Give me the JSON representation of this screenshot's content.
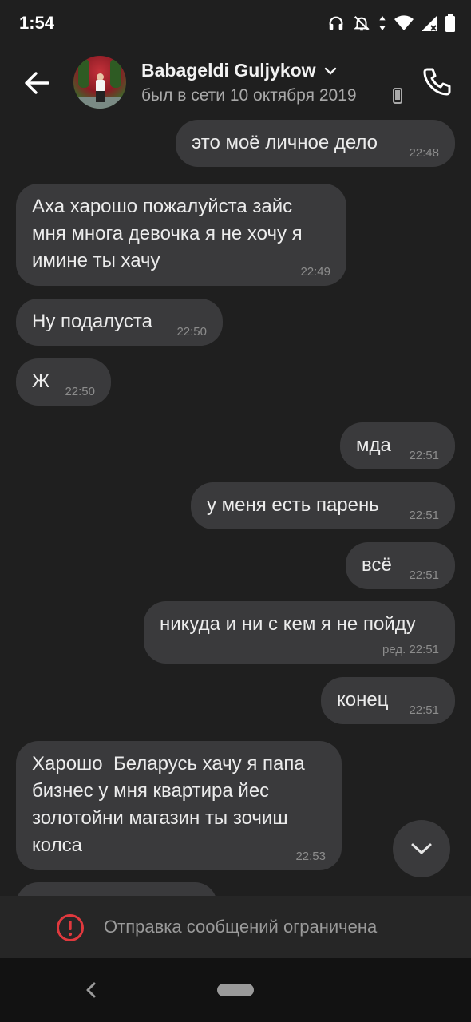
{
  "status_bar": {
    "time": "1:54",
    "icons": [
      "headphones-icon",
      "notifications-off-icon",
      "data-arrows-icon",
      "wifi-icon",
      "cell-signal-icon",
      "battery-icon"
    ]
  },
  "header": {
    "contact_name": "Babageldi Guljykow",
    "status": "был в сети 10 октября 2019",
    "icons": [
      "back-arrow-icon",
      "chevron-down-icon",
      "phone-device-icon",
      "call-icon"
    ]
  },
  "messages": [
    {
      "direction": "out",
      "text": "это моё личное дело",
      "time": "22:48"
    },
    {
      "direction": "in",
      "text": "Аха харошо пожалуйста зайс\nмня многа девочка я не хочу я\nимине ты хачу",
      "time": "22:49"
    },
    {
      "direction": "in",
      "text": "Ну подалуста",
      "time": "22:50"
    },
    {
      "direction": "in",
      "text": "Ж",
      "time": "22:50"
    },
    {
      "direction": "out",
      "text": "мда",
      "time": "22:51"
    },
    {
      "direction": "out",
      "text": "у меня есть парень",
      "time": "22:51"
    },
    {
      "direction": "out",
      "text": "всё",
      "time": "22:51"
    },
    {
      "direction": "out",
      "text": "никуда и ни с кем я не пойду",
      "time": "ред. 22:51"
    },
    {
      "direction": "out",
      "text": "конец",
      "time": "22:51"
    },
    {
      "direction": "in",
      "text": "Харошо  Беларусь хачу я папа\nбизнес у мня квартира йес\nзолотойни магазин ты зочиш\nколса",
      "time": "22:53"
    }
  ],
  "restriction": {
    "text": "Отправка сообщений ограничена",
    "icon": "error-icon",
    "color": "#e0393e"
  },
  "colors": {
    "background": "#1f1f1f",
    "bubble": "#3a3a3c"
  }
}
